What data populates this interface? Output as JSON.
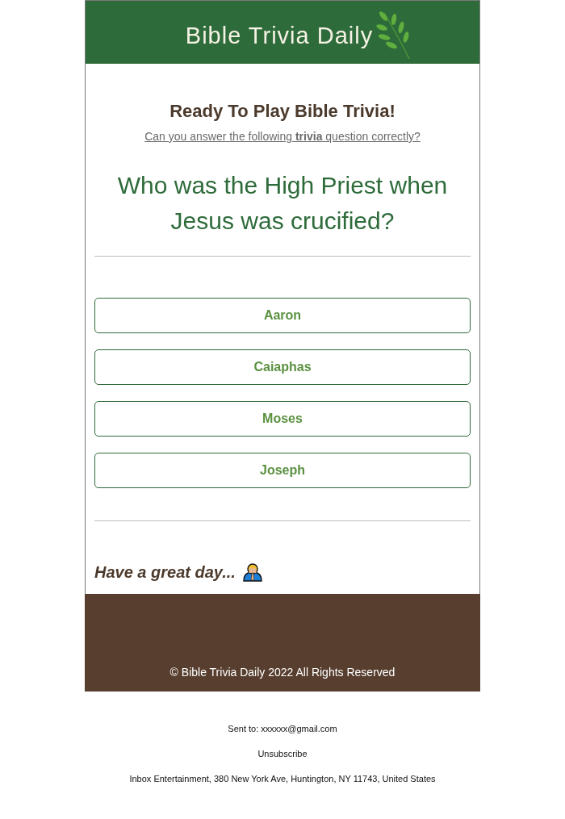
{
  "header": {
    "logo_text": "Bible Trivia Daily"
  },
  "intro": {
    "title": "Ready To Play Bible Trivia!",
    "subtitle": "Can you answer the following **trivia** question correctly?"
  },
  "question": "Who was the High Priest when Jesus was crucified?",
  "answers": [
    {
      "label": "Aaron",
      "selected": false
    },
    {
      "label": "Caiaphas",
      "selected": false
    },
    {
      "label": "Moses",
      "selected": false
    },
    {
      "label": "Joseph",
      "selected": false
    }
  ],
  "closing": "Have a great day...",
  "footer": {
    "copyright": "© Bible Trivia Daily 2022 All Rights Reserved"
  },
  "mailing": {
    "sent_to": "Sent to: xxxxxx@gmail.com",
    "unsubscribe": "Unsubscribe",
    "address": "Inbox Entertainment, 380 New York Ave, Huntington, NY 11743, United States"
  }
}
